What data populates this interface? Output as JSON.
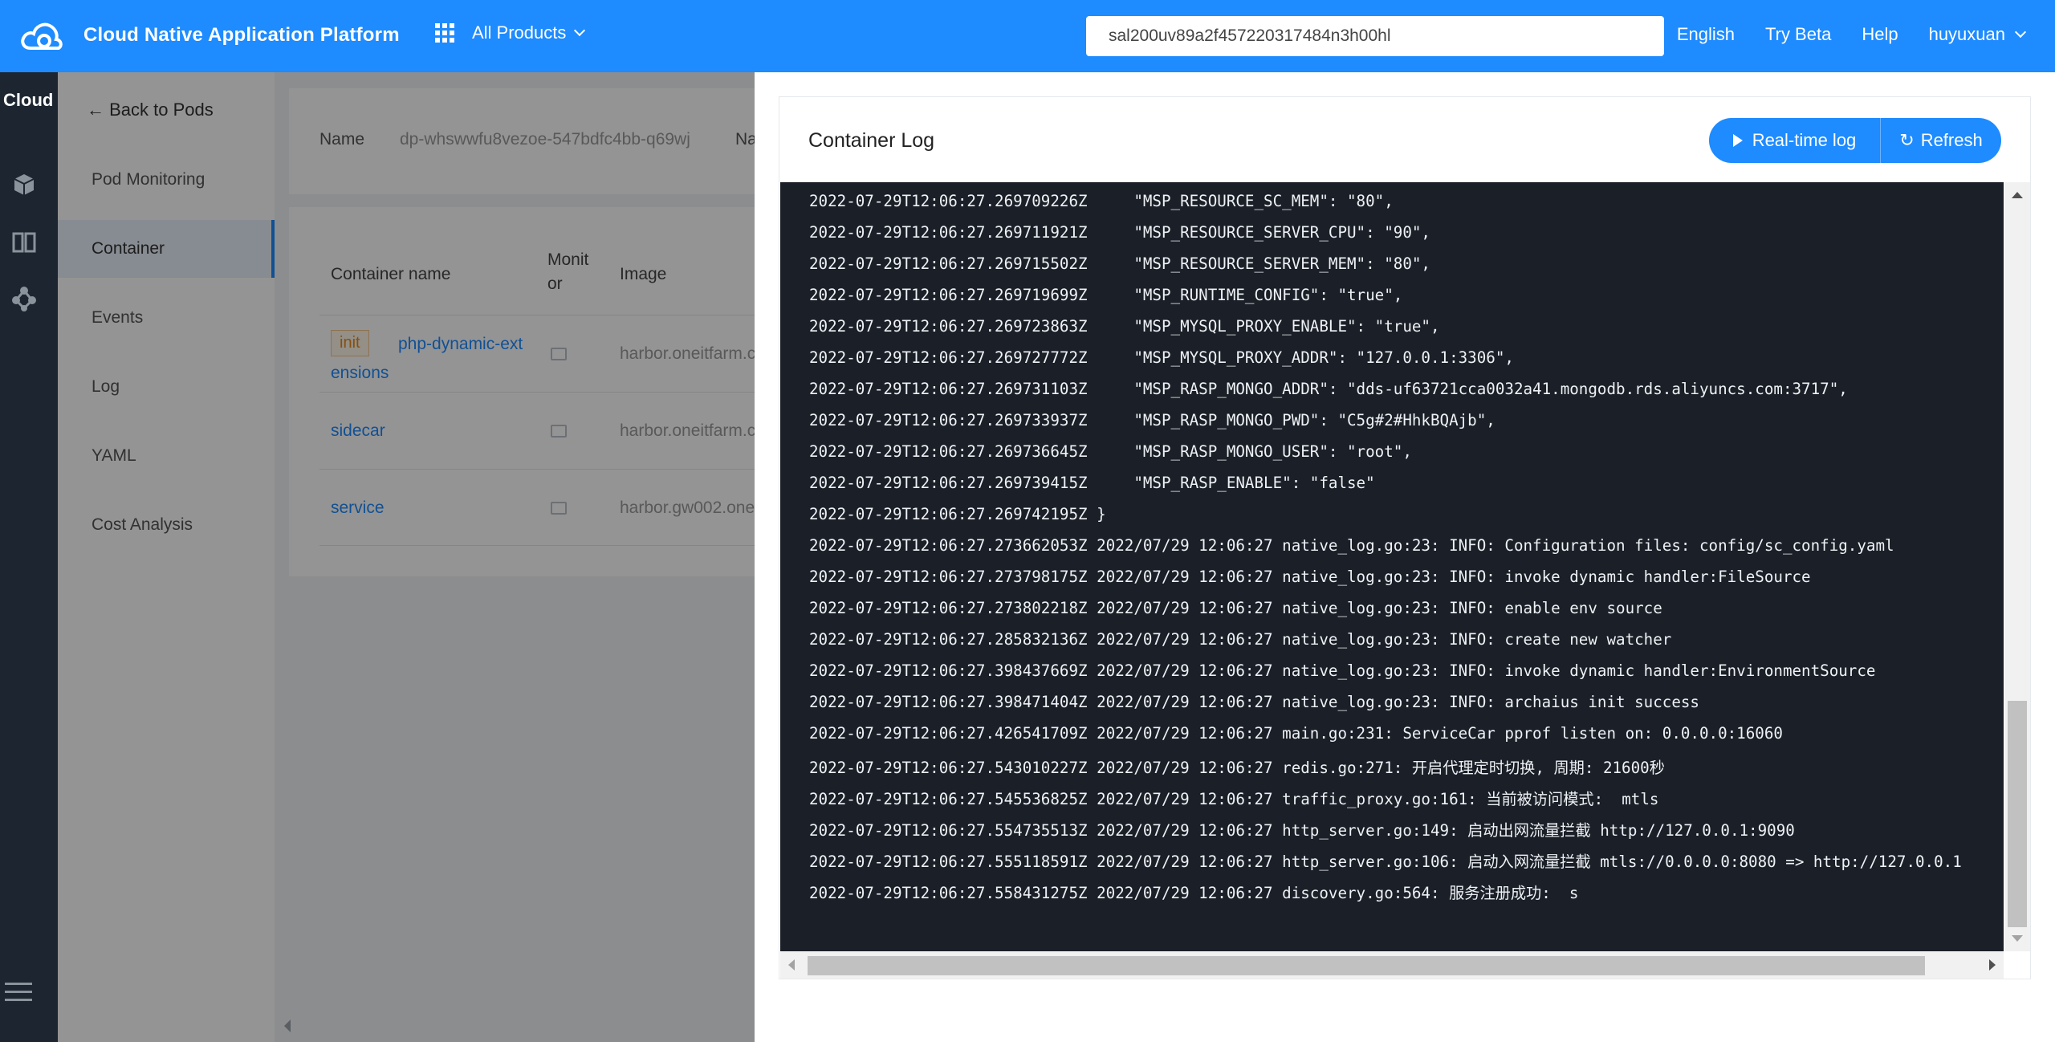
{
  "header": {
    "app_title": "Cloud Native Application Platform",
    "products_label": "All Products",
    "search_value": "sal200uv89a2f457220317484n3h00hl",
    "links": [
      "English",
      "Try Beta",
      "Help",
      "huyuxuan"
    ]
  },
  "rail": {
    "title": "Cloud"
  },
  "submenu": {
    "back_label": "← Back to Pods",
    "items": [
      "Pod Monitoring",
      "Container",
      "Events",
      "Log",
      "YAML",
      "Cost Analysis"
    ],
    "active": "Container"
  },
  "pod_info": {
    "name_label": "Name",
    "name_value": "dp-whswwfu8vezoe-547bdfc4bb-q69wj",
    "second_label": "Na"
  },
  "containers_table": {
    "headers": {
      "name": "Container name",
      "monitor_line1": "Monit",
      "monitor_line2": "or",
      "image": "Image"
    },
    "rows": [
      {
        "tag": "init",
        "name_line1": "php-dynamic-ext",
        "name_line2": "ensions",
        "image": "harbor.oneitfarm.c"
      },
      {
        "tag": "",
        "name_line1": "sidecar",
        "name_line2": "",
        "image": "harbor.oneitfarm.c"
      },
      {
        "tag": "",
        "name_line1": "service",
        "name_line2": "",
        "image": "harbor.gw002.one"
      }
    ]
  },
  "log_drawer": {
    "title": "Container Log",
    "realtime_label": "Real-time log",
    "refresh_label": "Refresh",
    "lines": [
      "2022-07-29T12:06:27.269709226Z     \"MSP_RESOURCE_SC_MEM\": \"80\",",
      "2022-07-29T12:06:27.269711921Z     \"MSP_RESOURCE_SERVER_CPU\": \"90\",",
      "2022-07-29T12:06:27.269715502Z     \"MSP_RESOURCE_SERVER_MEM\": \"80\",",
      "2022-07-29T12:06:27.269719699Z     \"MSP_RUNTIME_CONFIG\": \"true\",",
      "2022-07-29T12:06:27.269723863Z     \"MSP_MYSQL_PROXY_ENABLE\": \"true\",",
      "2022-07-29T12:06:27.269727772Z     \"MSP_MYSQL_PROXY_ADDR\": \"127.0.0.1:3306\",",
      "2022-07-29T12:06:27.269731103Z     \"MSP_RASP_MONGO_ADDR\": \"dds-uf63721cca0032a41.mongodb.rds.aliyuncs.com:3717\",",
      "2022-07-29T12:06:27.269733937Z     \"MSP_RASP_MONGO_PWD\": \"C5g#2#HhkBQAjb\",",
      "2022-07-29T12:06:27.269736645Z     \"MSP_RASP_MONGO_USER\": \"root\",",
      "2022-07-29T12:06:27.269739415Z     \"MSP_RASP_ENABLE\": \"false\"",
      "2022-07-29T12:06:27.269742195Z }",
      "2022-07-29T12:06:27.273662053Z 2022/07/29 12:06:27 native_log.go:23: INFO: Configuration files: config/sc_config.yaml",
      "2022-07-29T12:06:27.273798175Z 2022/07/29 12:06:27 native_log.go:23: INFO: invoke dynamic handler:FileSource",
      "2022-07-29T12:06:27.273802218Z 2022/07/29 12:06:27 native_log.go:23: INFO: enable env source",
      "2022-07-29T12:06:27.285832136Z 2022/07/29 12:06:27 native_log.go:23: INFO: create new watcher",
      "2022-07-29T12:06:27.398437669Z 2022/07/29 12:06:27 native_log.go:23: INFO: invoke dynamic handler:EnvironmentSource",
      "2022-07-29T12:06:27.398471404Z 2022/07/29 12:06:27 native_log.go:23: INFO: archaius init success",
      "2022-07-29T12:06:27.426541709Z 2022/07/29 12:06:27 main.go:231: ServiceCar pprof listen on: 0.0.0.0:16060",
      "2022-07-29T12:06:27.543010227Z 2022/07/29 12:06:27 redis.go:271: 开启代理定时切换, 周期: 21600秒",
      "2022-07-29T12:06:27.545536825Z 2022/07/29 12:06:27 traffic_proxy.go:161: 当前被访问模式:  mtls",
      "2022-07-29T12:06:27.554735513Z 2022/07/29 12:06:27 http_server.go:149: 启动出网流量拦截 http://127.0.0.1:9090",
      "2022-07-29T12:06:27.555118591Z 2022/07/29 12:06:27 http_server.go:106: 启动入网流量拦截 mtls://0.0.0.0:8080 => http://127.0.0.1",
      "2022-07-29T12:06:27.558431275Z 2022/07/29 12:06:27 discovery.go:564: 服务注册成功:  s"
    ]
  }
}
